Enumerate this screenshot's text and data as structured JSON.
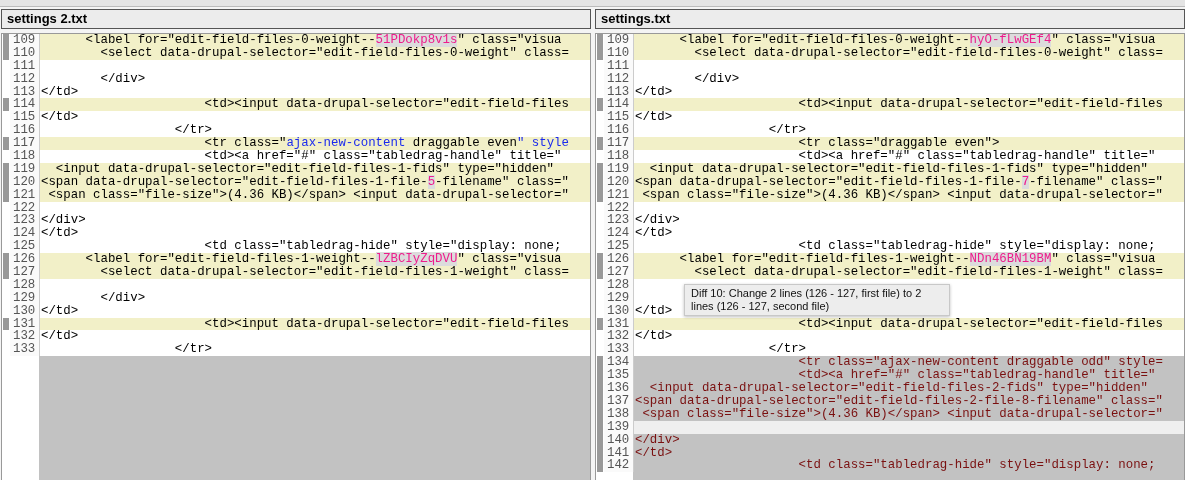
{
  "panes": [
    {
      "title": "settings 2.txt",
      "lines": [
        {
          "num": "109",
          "kind": "changed",
          "parts": [
            {
              "text": "      <label for=\"edit-field-files-0-weight--",
              "kind": "same"
            },
            {
              "text": "51PDokp8v1s",
              "kind": "changed"
            },
            {
              "text": "\" class=\"visua",
              "kind": "same"
            }
          ]
        },
        {
          "num": "110",
          "kind": "changed",
          "text": "        <select data-drupal-selector=\"edit-field-files-0-weight\" class="
        },
        {
          "num": "111",
          "kind": "plain"
        },
        {
          "num": "112",
          "kind": "plain",
          "text": "        </div>"
        },
        {
          "num": "113",
          "kind": "plain",
          "text": "</td>"
        },
        {
          "num": "114",
          "kind": "changed",
          "text": "                      <td><input data-drupal-selector=\"edit-field-files"
        },
        {
          "num": "115",
          "kind": "plain",
          "text": "</td>"
        },
        {
          "num": "116",
          "kind": "plain",
          "text": "                  </tr>"
        },
        {
          "num": "117",
          "kind": "changed",
          "parts": [
            {
              "text": "                      <tr class=\"",
              "kind": "same"
            },
            {
              "text": "ajax-new-content",
              "kind": "inserted"
            },
            {
              "text": " draggable even",
              "kind": "same"
            },
            {
              "text": "\" style",
              "kind": "inserted"
            }
          ]
        },
        {
          "num": "118",
          "kind": "plain",
          "text": "                      <td><a href=\"#\" class=\"tabledrag-handle\" title=\""
        },
        {
          "num": "119",
          "kind": "changed",
          "text": "  <input data-drupal-selector=\"edit-field-files-1-fids\" type=\"hidden\""
        },
        {
          "num": "120",
          "kind": "changed",
          "parts": [
            {
              "text": "<span data-drupal-selector=\"edit-field-files-1-file-",
              "kind": "same"
            },
            {
              "text": "5",
              "kind": "changed"
            },
            {
              "text": "-filename\" class=\"",
              "kind": "same"
            }
          ]
        },
        {
          "num": "121",
          "kind": "changed",
          "text": " <span class=\"file-size\">(4.36 KB)</span> <input data-drupal-selector=\""
        },
        {
          "num": "122",
          "kind": "plain"
        },
        {
          "num": "123",
          "kind": "plain",
          "text": "</div>"
        },
        {
          "num": "124",
          "kind": "plain",
          "text": "</td>"
        },
        {
          "num": "125",
          "kind": "plain",
          "text": "                      <td class=\"tabledrag-hide\" style=\"display: none;"
        },
        {
          "num": "126",
          "kind": "changed",
          "parts": [
            {
              "text": "      <label for=\"edit-field-files-1-weight--",
              "kind": "same"
            },
            {
              "text": "lZBCIyZqDVU",
              "kind": "changed"
            },
            {
              "text": "\" class=\"visua",
              "kind": "same"
            }
          ]
        },
        {
          "num": "127",
          "kind": "changed",
          "text": "        <select data-drupal-selector=\"edit-field-files-1-weight\" class="
        },
        {
          "num": "128",
          "kind": "plain"
        },
        {
          "num": "129",
          "kind": "plain",
          "text": "        </div>"
        },
        {
          "num": "130",
          "kind": "plain",
          "text": "</td>"
        },
        {
          "num": "131",
          "kind": "changed",
          "text": "                      <td><input data-drupal-selector=\"edit-field-files"
        },
        {
          "num": "132",
          "kind": "plain",
          "text": "</td>"
        },
        {
          "num": "133",
          "kind": "plain",
          "text": "                  </tr>"
        }
      ]
    },
    {
      "title": "settings.txt",
      "lines": [
        {
          "num": "109",
          "kind": "changed",
          "parts": [
            {
              "text": "      <label for=\"edit-field-files-0-weight--",
              "kind": "same"
            },
            {
              "text": "hyO-fLwGEf4",
              "kind": "changed"
            },
            {
              "text": "\" class=\"visua",
              "kind": "same"
            }
          ]
        },
        {
          "num": "110",
          "kind": "changed",
          "text": "        <select data-drupal-selector=\"edit-field-files-0-weight\" class="
        },
        {
          "num": "111",
          "kind": "plain"
        },
        {
          "num": "112",
          "kind": "plain",
          "text": "        </div>"
        },
        {
          "num": "113",
          "kind": "plain",
          "text": "</td>"
        },
        {
          "num": "114",
          "kind": "changed",
          "text": "                      <td><input data-drupal-selector=\"edit-field-files"
        },
        {
          "num": "115",
          "kind": "plain",
          "text": "</td>"
        },
        {
          "num": "116",
          "kind": "plain",
          "text": "                  </tr>"
        },
        {
          "num": "117",
          "kind": "changed",
          "text": "                      <tr class=\"draggable even\">"
        },
        {
          "num": "118",
          "kind": "plain",
          "text": "                      <td><a href=\"#\" class=\"tabledrag-handle\" title=\""
        },
        {
          "num": "119",
          "kind": "changed",
          "text": "  <input data-drupal-selector=\"edit-field-files-1-fids\" type=\"hidden\""
        },
        {
          "num": "120",
          "kind": "changed",
          "parts": [
            {
              "text": "<span data-drupal-selector=\"edit-field-files-1-file-",
              "kind": "same"
            },
            {
              "text": "7",
              "kind": "changed"
            },
            {
              "text": "-filename\" class=\"",
              "kind": "same"
            }
          ]
        },
        {
          "num": "121",
          "kind": "changed",
          "text": " <span class=\"file-size\">(4.36 KB)</span> <input data-drupal-selector=\""
        },
        {
          "num": "122",
          "kind": "plain"
        },
        {
          "num": "123",
          "kind": "plain",
          "text": "</div>"
        },
        {
          "num": "124",
          "kind": "plain",
          "text": "</td>"
        },
        {
          "num": "125",
          "kind": "plain",
          "text": "                      <td class=\"tabledrag-hide\" style=\"display: none;"
        },
        {
          "num": "126",
          "kind": "changed",
          "parts": [
            {
              "text": "      <label for=\"edit-field-files-1-weight--",
              "kind": "same"
            },
            {
              "text": "NDn46BN19BM",
              "kind": "changed"
            },
            {
              "text": "\" class=\"visua",
              "kind": "same"
            }
          ]
        },
        {
          "num": "127",
          "kind": "changed",
          "text": "        <select data-drupal-selector=\"edit-field-files-1-weight\" class="
        },
        {
          "num": "128",
          "kind": "plain",
          "tooltip": "Diff 10: Change 2 lines (126 - 127, first file) to 2 lines (126 - 127, second file)"
        },
        {
          "num": "129",
          "kind": "plain"
        },
        {
          "num": "130",
          "kind": "plain",
          "text": "</td>"
        },
        {
          "num": "131",
          "kind": "changed",
          "text": "                      <td><input data-drupal-selector=\"edit-field-files"
        },
        {
          "num": "132",
          "kind": "plain",
          "text": "</td>"
        },
        {
          "num": "133",
          "kind": "plain",
          "text": "                  </tr>"
        },
        {
          "num": "134",
          "kind": "added",
          "text": "                      <tr class=\"ajax-new-content draggable odd\" style="
        },
        {
          "num": "135",
          "kind": "added",
          "text": "                      <td><a href=\"#\" class=\"tabledrag-handle\" title=\""
        },
        {
          "num": "136",
          "kind": "added",
          "text": "  <input data-drupal-selector=\"edit-field-files-2-fids\" type=\"hidden\""
        },
        {
          "num": "137",
          "kind": "added",
          "text": "<span data-drupal-selector=\"edit-field-files-2-file-8-filename\" class=\""
        },
        {
          "num": "138",
          "kind": "added",
          "text": " <span class=\"file-size\">(4.36 KB)</span> <input data-drupal-selector=\""
        },
        {
          "num": "139",
          "kind": "empty"
        },
        {
          "num": "140",
          "kind": "added",
          "text": "</div>"
        },
        {
          "num": "141",
          "kind": "added",
          "text": "</td>"
        },
        {
          "num": "142",
          "kind": "added",
          "text": "                      <td class=\"tabledrag-hide\" style=\"display: none;"
        }
      ]
    }
  ]
}
